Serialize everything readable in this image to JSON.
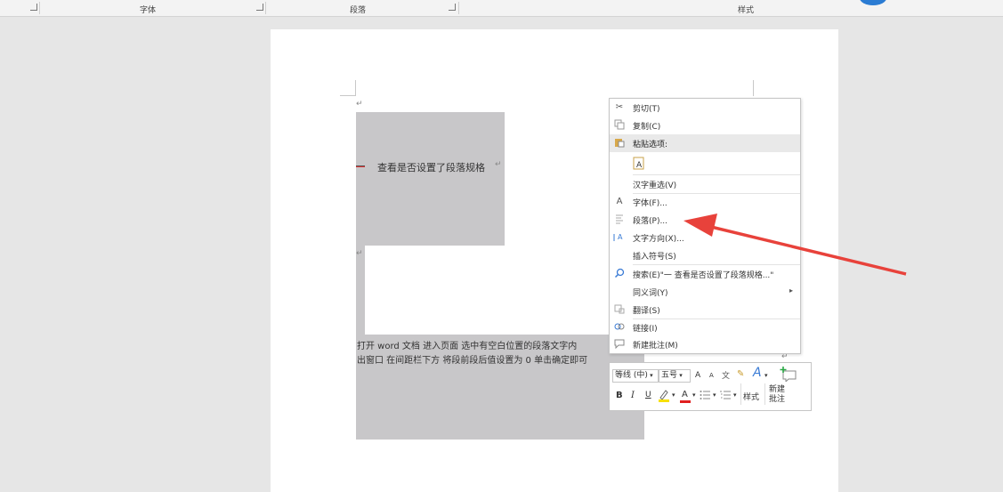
{
  "ribbon": {
    "group_font": "字体",
    "group_paragraph": "段落",
    "group_styles": "样式"
  },
  "document": {
    "heading": "查看是否设置了段落规格",
    "return_mark": "↵",
    "body_line1": "打开 word 文档   进入页面   选中有空白位置的段落文字内",
    "body_line2": "出窗口   在间距栏下方   将段前段后值设置为 0   单击确定即可"
  },
  "context_menu": {
    "items": [
      {
        "label": "剪切(T)",
        "icon": "scissors-icon"
      },
      {
        "label": "复制(C)",
        "icon": "copy-icon"
      },
      {
        "label": "粘贴选项:",
        "icon": "paste-icon"
      },
      {
        "label": "汉字重选(V)",
        "icon": ""
      },
      {
        "label": "字体(F)...",
        "icon": "font-icon"
      },
      {
        "label": "段落(P)...",
        "icon": "paragraph-icon"
      },
      {
        "label": "文字方向(X)...",
        "icon": "text-direction-icon"
      },
      {
        "label": "插入符号(S)",
        "icon": ""
      },
      {
        "label": "搜索(E)\"一  查看是否设置了段落规格...\"",
        "icon": "search-icon"
      },
      {
        "label": "同义词(Y)",
        "icon": ""
      },
      {
        "label": "翻译(S)",
        "icon": "translate-icon"
      },
      {
        "label": "链接(I)",
        "icon": "link-icon"
      },
      {
        "label": "新建批注(M)",
        "icon": "comment-icon"
      }
    ]
  },
  "mini_toolbar": {
    "font_name": "等线 (中)",
    "font_size": "五号",
    "styles_label": "样式",
    "new_comment_line1": "新建",
    "new_comment_line2": "批注",
    "bold": "B",
    "italic": "I",
    "underline": "U",
    "font_color_letter": "A",
    "grow_font": "A",
    "shrink_font": "A"
  },
  "colors": {
    "selection": "#c8c7c9",
    "annotation_arrow": "#e8423b",
    "font_color_bar": "#e02020",
    "highlight_bar": "#f7e000"
  }
}
